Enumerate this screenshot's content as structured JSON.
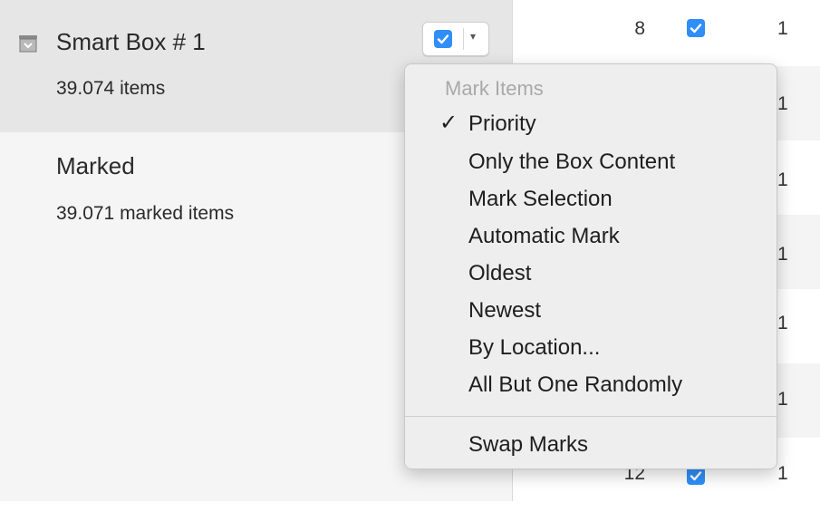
{
  "sidebar": {
    "smart_box": {
      "title": "Smart Box # 1",
      "subtitle": "39.074 items",
      "icon": "smart-box-icon"
    },
    "marked": {
      "title": "Marked",
      "subtitle": "39.071 marked items"
    }
  },
  "popup_button": {
    "checked": true,
    "arrow_glyph": "▾"
  },
  "list": {
    "rows": [
      {
        "number": "8",
        "checked": true,
        "count": "1"
      },
      {
        "number": "",
        "checked": false,
        "count": "1"
      },
      {
        "number": "",
        "checked": false,
        "count": "1"
      },
      {
        "number": "",
        "checked": false,
        "count": "1"
      },
      {
        "number": "",
        "checked": false,
        "count": "1"
      },
      {
        "number": "",
        "checked": false,
        "count": "1"
      },
      {
        "number": "12",
        "checked": true,
        "count": "1"
      }
    ]
  },
  "menu": {
    "header": "Mark Items",
    "check_glyph": "✓",
    "items": [
      {
        "label": "Priority",
        "checked": true
      },
      {
        "label": "Only the Box Content",
        "checked": false
      },
      {
        "label": "Mark Selection",
        "checked": false
      },
      {
        "label": "Automatic Mark",
        "checked": false
      },
      {
        "label": "Oldest",
        "checked": false
      },
      {
        "label": "Newest",
        "checked": false
      },
      {
        "label": "By Location...",
        "checked": false
      },
      {
        "label": "All But One Randomly",
        "checked": false
      }
    ],
    "footer_item": {
      "label": "Swap Marks"
    }
  },
  "colors": {
    "accent": "#2f8ef8",
    "selected_bg": "#e6e6e6",
    "sidebar_bg": "#f5f5f5"
  }
}
